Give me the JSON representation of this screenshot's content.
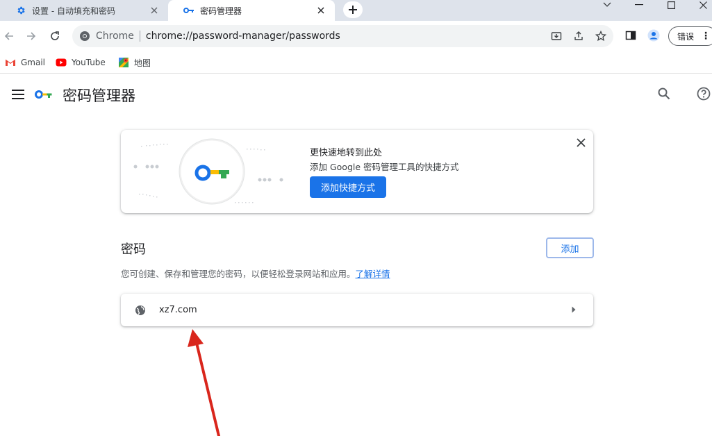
{
  "tabs": [
    {
      "label": "设置 - 自动填充和密码",
      "icon": "gear-icon",
      "active": false
    },
    {
      "label": "密码管理器",
      "icon": "key-icon",
      "active": true
    }
  ],
  "toolbar": {
    "omnibox_chip": "Chrome",
    "url": "chrome://password-manager/passwords",
    "profile_pill_label": "错误"
  },
  "bookmarks": [
    {
      "label": "Gmail",
      "icon": "gmail-icon"
    },
    {
      "label": "YouTube",
      "icon": "youtube-icon"
    },
    {
      "label": "地图",
      "icon": "maps-icon"
    }
  ],
  "page": {
    "title": "密码管理器"
  },
  "promo": {
    "title": "更快速地转到此处",
    "description": "添加 Google 密码管理工具的快捷方式",
    "button_label": "添加快捷方式"
  },
  "passwords": {
    "section_title": "密码",
    "add_button_label": "添加",
    "description": "您可创建、保存和管理您的密码，以便轻松登录网站和应用。",
    "learn_more": "了解详情",
    "items": [
      {
        "site": "xz7.com",
        "icon": "globe-icon"
      }
    ]
  },
  "colors": {
    "accent": "#1a73e8",
    "tabstrip": "#dee3eb",
    "annotation_arrow": "#d9261c"
  }
}
